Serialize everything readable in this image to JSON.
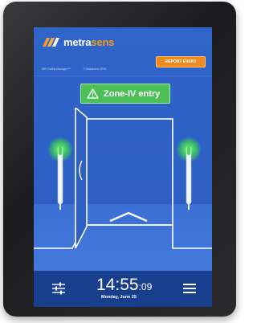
{
  "brand": {
    "name_part1": "metra",
    "name_part2": "sens",
    "accent": "#f59a22"
  },
  "meta": {
    "product": "MRI Safety Manager™",
    "copyright": "© Metrasens 2018"
  },
  "report_button": {
    "label": "REPORT EVENT"
  },
  "zone_alert": {
    "label": "Zone-IV entry",
    "color": "#4dbf57"
  },
  "status": {
    "time_hm": "14:55",
    "time_s": ":09",
    "date": "Monday, June 25"
  },
  "icons": [
    "logo-icon",
    "warning-icon",
    "sliders-icon",
    "menu-icon",
    "up-arrow-icon"
  ]
}
